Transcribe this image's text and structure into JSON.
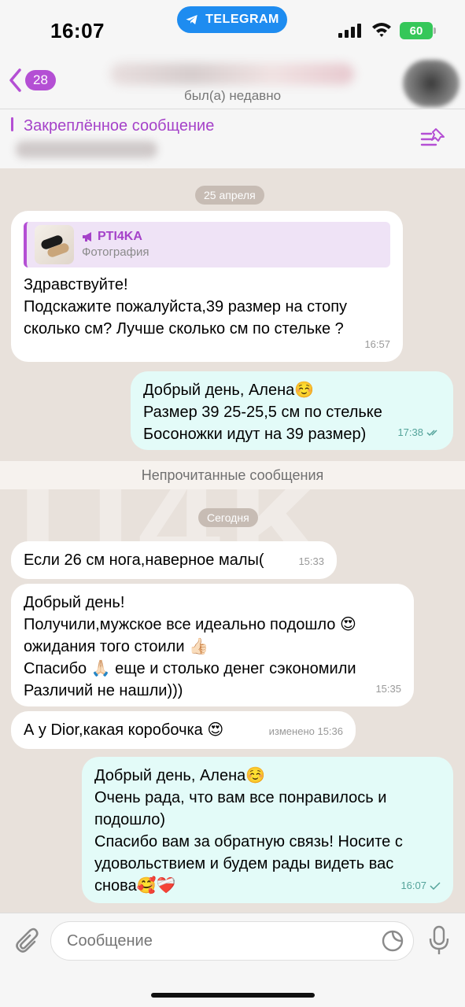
{
  "status_bar": {
    "time": "16:07",
    "app_pill": "TELEGRAM",
    "battery": "60"
  },
  "header": {
    "back_count": "28",
    "status": "был(а) недавно"
  },
  "pinned": {
    "title": "Закреплённое сообщение"
  },
  "watermark": "TI4K",
  "messages": {
    "date1": "25 апреля",
    "m1": {
      "quote_name": "PTI4KA",
      "quote_sub": "Фотография",
      "lines": [
        "Здравствуйте!",
        "Подскажите пожалуйста,39 размер на стопу",
        "сколько см? Лучше сколько см по стельке ?"
      ],
      "time": "16:57"
    },
    "m2": {
      "lines": [
        "Добрый день, Алена☺️",
        "Размер 39 25-25,5 см по стельке",
        "Босоножки идут на 39 размер)"
      ],
      "time": "17:38"
    },
    "unread": "Непрочитанные сообщения",
    "date2": "Сегодня",
    "m3": {
      "text": "Если 26 см нога,наверное малы(",
      "time": "15:33"
    },
    "m4": {
      "lines": [
        "Добрый день!",
        "Получили,мужское все идеально подошло 😍",
        "ожидания того стоили 👍🏻",
        "Спасибо 🙏🏻 еще и столько денег сэкономили",
        "Различий не нашли)))"
      ],
      "time": "15:35"
    },
    "m5": {
      "text": "А у Dior,какая коробочка 😍",
      "time": "изменено 15:36"
    },
    "m6": {
      "lines": [
        "Добрый день, Алена☺️",
        "Очень рада, что вам все понравилось и",
        "подошло)",
        "Спасибо вам за обратную связь! Носите с",
        "удовольствием и будем рады видеть вас",
        "снова🥰❤️‍🩹"
      ],
      "time": "16:07"
    }
  },
  "input": {
    "placeholder": "Сообщение"
  },
  "colors": {
    "accent": "#b44fd4",
    "telegram_blue": "#1e8cf0",
    "outgoing_bubble": "#e3fbf8",
    "incoming_bubble": "#ffffff",
    "chat_bg": "#e8e1db"
  }
}
